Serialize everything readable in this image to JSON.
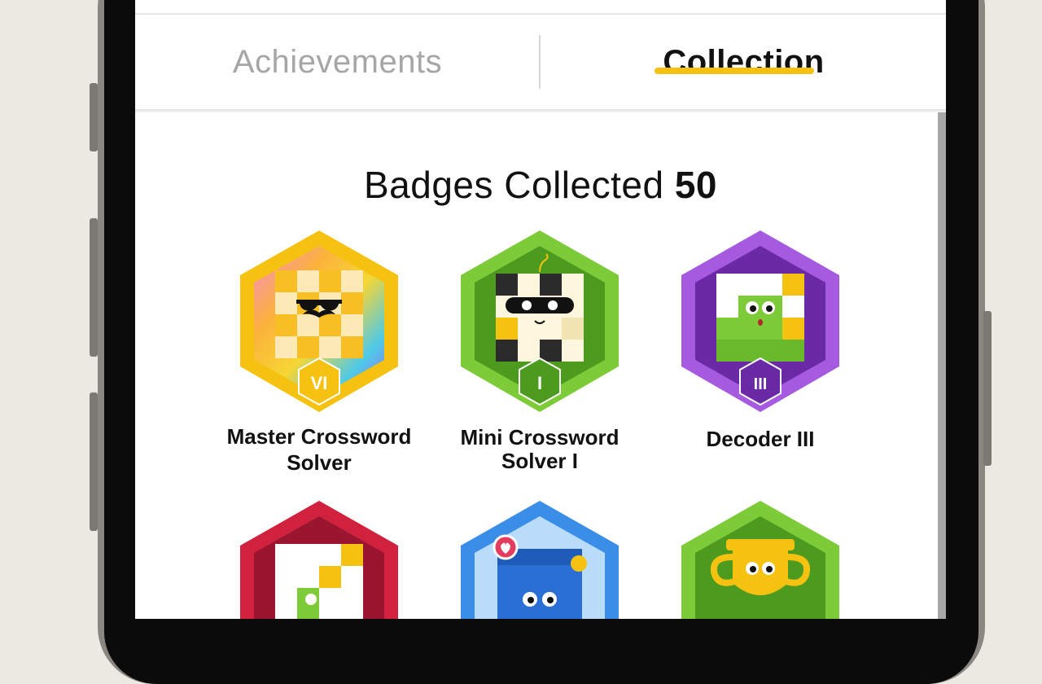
{
  "tabs": {
    "achievements": "Achievements",
    "collection": "Collection",
    "active": "collection"
  },
  "header": {
    "title_prefix": "Badges Collected",
    "count": "50"
  },
  "badges": [
    {
      "name": "Master Crossword Solver",
      "line1": "Master Crossword",
      "line2": "Solver",
      "level": "VI",
      "color": "#f6c211"
    },
    {
      "name": "Mini Crossword Solver I",
      "line1": "Mini Crossword",
      "line2": "Solver I",
      "level": "I",
      "color": "#6ab92c"
    },
    {
      "name": "Decoder III",
      "line1": "Decoder III",
      "line2": "",
      "level": "III",
      "color": "#8a3dc9"
    },
    {
      "name": "",
      "line1": "",
      "line2": "",
      "level": "",
      "color": "#d0223f"
    },
    {
      "name": "",
      "line1": "",
      "line2": "",
      "level": "",
      "color": "#3b8ee8"
    },
    {
      "name": "",
      "line1": "",
      "line2": "",
      "level": "",
      "color": "#6ab92c"
    }
  ],
  "colors": {
    "accent": "#f6c211",
    "tab_inactive": "#a6a6a6"
  }
}
